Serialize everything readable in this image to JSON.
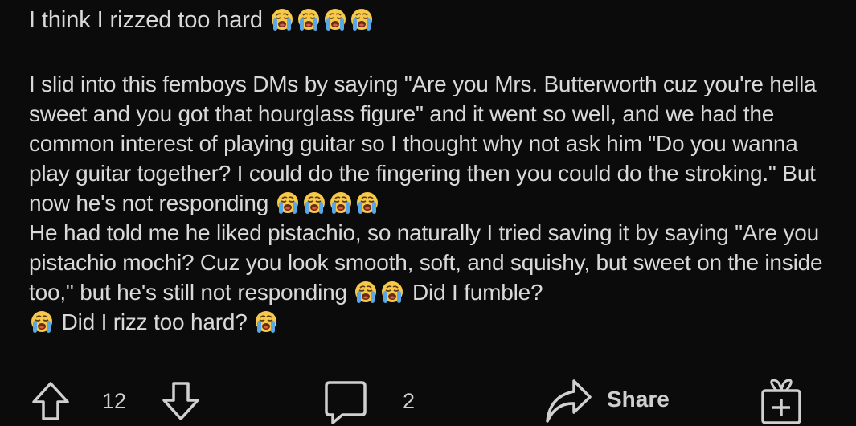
{
  "post": {
    "title": "I think I rizzed too hard",
    "body_segments": [
      "I slid into this femboys DMs by saying \"Are you Mrs. Butterworth cuz you're hella sweet and you got that hourglass figure\" and it went so well, and we had the common interest of playing guitar so I thought why not ask him \"Do you wanna play guitar together? I could do the fingering then you could do the stroking.\" But now he's not responding ",
      "He had told me he liked pistachio, so naturally I tried saving it by saying \"Are you pistachio mochi? Cuz you look smooth, soft, and squishy, but sweet on the inside too,\" but he's still not responding ",
      " Did I fumble? ",
      " Did I rizz too hard? "
    ],
    "emoji_name": "loudly-crying-face-emoji"
  },
  "actions": {
    "upvote_icon": "upvote-arrow-icon",
    "vote_count": "12",
    "downvote_icon": "downvote-arrow-icon",
    "comment_icon": "comment-bubble-icon",
    "comment_count": "2",
    "share_icon": "share-arrow-icon",
    "share_label": "Share",
    "award_icon": "award-gift-icon"
  },
  "colors": {
    "background": "#0b0b0b",
    "text": "#d9d9d9",
    "emoji_face": "#f7c94a",
    "emoji_tears": "#5aa7e6"
  }
}
